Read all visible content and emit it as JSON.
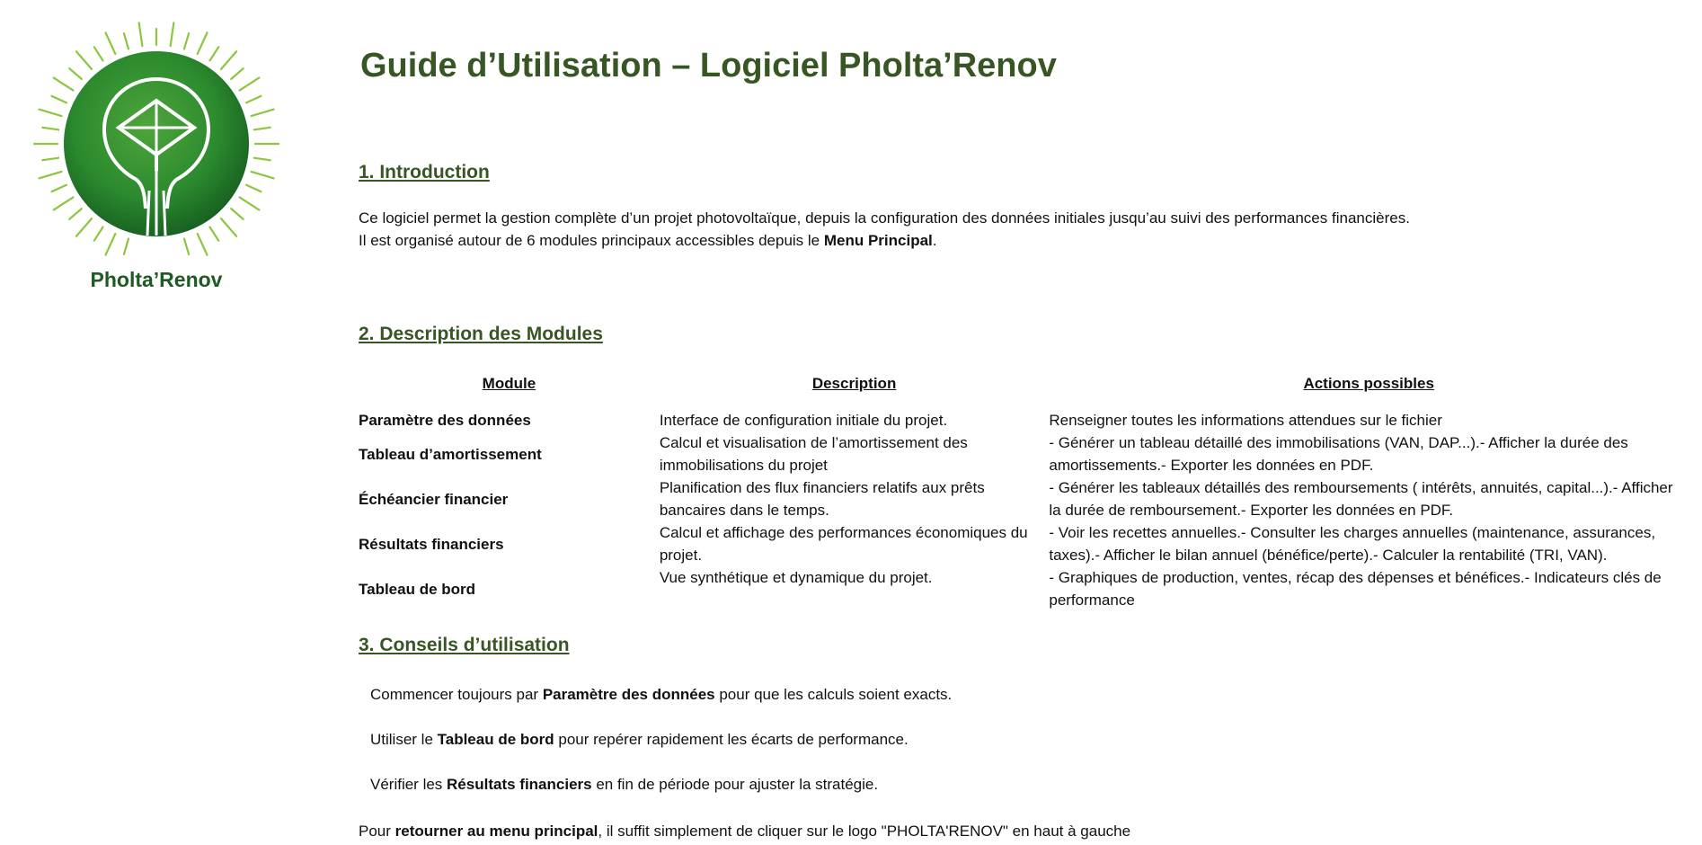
{
  "logo": {
    "name": "Pholta’Renov",
    "colors": {
      "primary": "#1e6b26",
      "light": "#4ea53a",
      "ray": "#8cc63f"
    }
  },
  "title": "Guide d’Utilisation – Logiciel Pholta’Renov",
  "intro": {
    "heading": "1. Introduction",
    "line1": "Ce logiciel permet la gestion complète d’un projet photovoltaïque, depuis la configuration des données initiales jusqu’au suivi des performances financières.",
    "line2_prefix": "Il est organisé autour de 6 modules principaux accessibles depuis le ",
    "line2_bold": "Menu Principal",
    "line2_suffix": "."
  },
  "modules": {
    "heading": "2. Description des Modules",
    "columns": [
      "Module",
      "Description",
      "Actions possibles"
    ],
    "rows": [
      {
        "module": "Paramètre des données",
        "description": "Interface de configuration initiale du projet.",
        "actions": "Renseigner toutes les informations attendues sur le fichier"
      },
      {
        "module": "Tableau d’amortissement",
        "description": "Calcul et visualisation de l’amortissement des immobilisations du projet",
        "actions": "- Générer un tableau détaillé des immobilisations (VAN, DAP...).- Afficher la durée des amortissements.- Exporter les données en PDF."
      },
      {
        "module": "Échéancier financier",
        "description": "Planification des flux financiers relatifs aux prêts bancaires dans le temps.",
        "actions": "- Générer les tableaux détaillés des remboursements ( intérêts, annuités, capital...).- Afficher la durée de remboursement.- Exporter les données en PDF."
      },
      {
        "module": "Résultats financiers",
        "description": "Calcul et affichage des performances économiques du projet.",
        "actions": "- Voir les recettes annuelles.- Consulter les charges annuelles (maintenance, assurances, taxes).- Afficher le bilan annuel (bénéfice/perte).- Calculer la rentabilité (TRI, VAN)."
      },
      {
        "module": "Tableau de bord",
        "description": "Vue synthétique et dynamique du projet.",
        "actions": "- Graphiques de production, ventes, récap des dépenses et bénéfices.- Indicateurs clés de performance"
      }
    ]
  },
  "tips": {
    "heading": "3. Conseils d’utilisation",
    "items": [
      {
        "prefix": "Commencer toujours par ",
        "bold": "Paramètre des données",
        "suffix": " pour que les calculs soient exacts."
      },
      {
        "prefix": "Utiliser le ",
        "bold": "Tableau de bord",
        "suffix": " pour repérer rapidement les écarts de performance."
      },
      {
        "prefix": "Vérifier les ",
        "bold": "Résultats financiers",
        "suffix": " en fin de période pour ajuster la stratégie."
      }
    ]
  },
  "footer": {
    "prefix": "Pour ",
    "bold": "retourner au menu principal",
    "suffix": ", il suffit simplement de cliquer sur le logo \"PHOLTA'RENOV\" en haut à gauche"
  }
}
